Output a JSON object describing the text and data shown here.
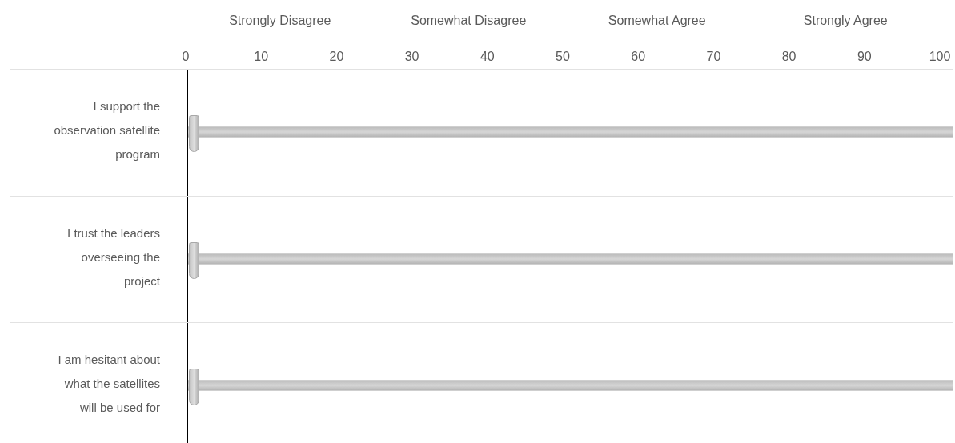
{
  "scale": {
    "anchors": [
      "Strongly Disagree",
      "Somewhat Disagree",
      "Somewhat Agree",
      "Strongly Agree"
    ],
    "ticks": [
      "0",
      "10",
      "20",
      "30",
      "40",
      "50",
      "60",
      "70",
      "80",
      "90",
      "100"
    ]
  },
  "statements": [
    {
      "label": "I support the observation satellite program",
      "level": 0
    },
    {
      "label": "I trust the leaders overseeing the project",
      "level": 0
    },
    {
      "label": "I am hesitant about what the satellites will be used for",
      "level": 0
    }
  ]
}
